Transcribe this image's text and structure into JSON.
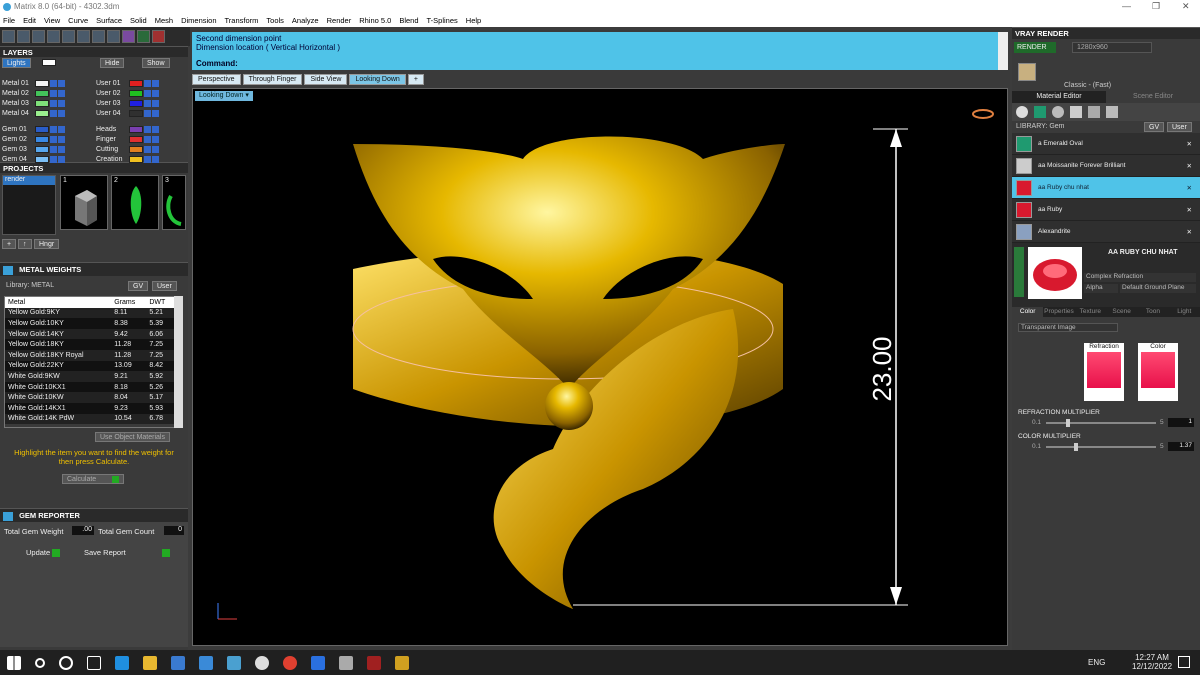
{
  "window": {
    "title": "Matrix 8.0 (64-bit) - 4302.3dm"
  },
  "menu": [
    "File",
    "Edit",
    "View",
    "Curve",
    "Surface",
    "Solid",
    "Mesh",
    "Dimension",
    "Transform",
    "Tools",
    "Analyze",
    "Render",
    "Rhino 5.0",
    "Blend",
    "T-Splines",
    "Help"
  ],
  "layers": {
    "title": "LAYERS",
    "lights": "Lights",
    "hide": "Hide",
    "show": "Show",
    "left": [
      {
        "name": "Metal 01",
        "color": "#f2f2f2"
      },
      {
        "name": "Metal 02",
        "color": "#43c35a"
      },
      {
        "name": "Metal 03",
        "color": "#7fe07a"
      },
      {
        "name": "Metal 04",
        "color": "#9bef8e"
      },
      {
        "name": "Gem 01",
        "color": "#2a5dc8"
      },
      {
        "name": "Gem 02",
        "color": "#3a8ae6"
      },
      {
        "name": "Gem 03",
        "color": "#58a8f0"
      },
      {
        "name": "Gem 04",
        "color": "#7cc0f6"
      }
    ],
    "right": [
      {
        "name": "User 01",
        "color": "#e02020"
      },
      {
        "name": "User 02",
        "color": "#20c020"
      },
      {
        "name": "User 03",
        "color": "#2020e0"
      },
      {
        "name": "User 04",
        "color": "#303030"
      },
      {
        "name": "Heads",
        "color": "#7a3fb0"
      },
      {
        "name": "Finger",
        "color": "#e03030"
      },
      {
        "name": "Cutting",
        "color": "#e08020"
      },
      {
        "name": "Creation",
        "color": "#f0c020"
      }
    ]
  },
  "projects": {
    "title": "PROJECTS",
    "item": "render",
    "nums": [
      "1",
      "2",
      "3"
    ],
    "hngr": "Hngr"
  },
  "metal_weights": {
    "title": "METAL WEIGHTS",
    "library": "Library: METAL",
    "gv": "GV",
    "user": "User",
    "headers": [
      "Metal",
      "Grams",
      "DWT"
    ],
    "rows": [
      [
        "Yellow Gold:9KY",
        "8.11",
        "5.21"
      ],
      [
        "Yellow Gold:10KY",
        "8.38",
        "5.39"
      ],
      [
        "Yellow Gold:14KY",
        "9.42",
        "6.06"
      ],
      [
        "Yellow Gold:18KY",
        "11.28",
        "7.25"
      ],
      [
        "Yellow Gold:18KY Royal",
        "11.28",
        "7.25"
      ],
      [
        "Yellow Gold:22KY",
        "13.09",
        "8.42"
      ],
      [
        "White Gold:9KW",
        "9.21",
        "5.92"
      ],
      [
        "White Gold:10KX1",
        "8.18",
        "5.26"
      ],
      [
        "White Gold:10KW",
        "8.04",
        "5.17"
      ],
      [
        "White Gold:14KX1",
        "9.23",
        "5.93"
      ],
      [
        "White Gold:14K PdW",
        "10.54",
        "6.78"
      ]
    ],
    "use_object": "Use Object Materials",
    "hint": "Highlight the item you want to find the weight for then press Calculate.",
    "calculate": "Calculate"
  },
  "gem_reporter": {
    "title": "GEM REPORTER",
    "total_weight_label": "Total Gem Weight",
    "total_weight": ".00",
    "total_count_label": "Total Gem Count",
    "total_count": "0",
    "update": "Update",
    "save": "Save Report"
  },
  "command": {
    "line1": "Second dimension point",
    "line2": "Dimension location ( Vertical  Horizontal )",
    "label": "Command:"
  },
  "tabs": [
    "Perspective",
    "Through Finger",
    "Side View",
    "Looking Down"
  ],
  "active_tab": "Looking Down",
  "view_label": "Looking Down",
  "dimension": "23.00",
  "vray": {
    "title": "VRAY RENDER",
    "render": "RENDER",
    "resolution": "1280x960",
    "preset": "Classic - (Fast)",
    "tabs": [
      "Material Editor",
      "Scene Editor"
    ],
    "library": "LIBRARY: Gem",
    "gv": "GV",
    "user": "User",
    "materials": [
      "a Emerald Oval",
      "aa Moissanite Forever Brilliant",
      "aa Ruby chu nhat",
      "aa Ruby",
      "Alexandrite"
    ],
    "selected": "aa Ruby chu nhat",
    "mat_name": "AA RUBY CHU NHAT",
    "mat_type": "Complex Refraction",
    "alpha": "Alpha",
    "ground": "Default Ground Plane",
    "prop_tabs": [
      "Color",
      "Properties",
      "Texture",
      "Scene",
      "Toon",
      "Light"
    ],
    "mode": "Transparent Image",
    "refraction": "Refraction",
    "color": "Color",
    "refr_mult": "REFRACTION MULTIPLIER",
    "refr_min": "0.1",
    "refr_max": "5",
    "refr_val": "1",
    "col_mult": "COLOR MULTIPLIER",
    "col_min": "0.1",
    "col_max": "5",
    "col_val": "1.37"
  },
  "taskbar": {
    "lang": "ENG",
    "time": "12:27 AM",
    "date": "12/12/2022"
  }
}
